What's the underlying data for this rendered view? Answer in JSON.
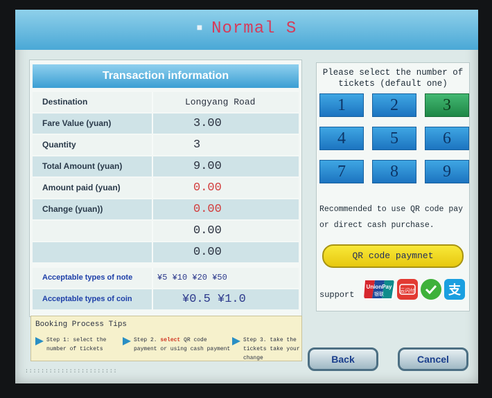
{
  "header": {
    "title": "Normal S"
  },
  "transaction": {
    "title": "Transaction information",
    "rows": [
      {
        "label": "Destination",
        "value": "Longyang Road"
      },
      {
        "label": "Fare Value (yuan)",
        "value": "3.00"
      },
      {
        "label": "Quantity",
        "value": "3"
      },
      {
        "label": "Total Amount (yuan)",
        "value": "9.00"
      },
      {
        "label": "Amount paid (yuan)",
        "value": "0.00"
      },
      {
        "label": "Change (yuan))",
        "value": "0.00"
      },
      {
        "label": "",
        "value": "0.00"
      },
      {
        "label": "",
        "value": "0.00"
      }
    ],
    "notes_label": "Acceptable types of note",
    "notes_value": "¥5 ¥10 ¥20 ¥50",
    "coins_label": "Acceptable types of coin",
    "coins_value": "¥0.5 ¥1.0"
  },
  "tickets": {
    "prompt": "Please select the number of tickets (default one)",
    "numbers": [
      "1",
      "2",
      "3",
      "4",
      "5",
      "6",
      "7",
      "8",
      "9"
    ],
    "selected": "3",
    "recommend": "Recommended to use QR code pay or direct cash purchase.",
    "qr_button": "QR code paymnet",
    "support_label": "support",
    "payment_icons": [
      "unionpay-icon",
      "cloud-quickpass-icon",
      "wechat-pay-icon",
      "alipay-icon"
    ],
    "unionpay_text": "UnionPay",
    "unionpay_sub": "银联",
    "quickpass_text": "云闪付",
    "alipay_glyph": "支"
  },
  "tips": {
    "title": "Booking Process Tips",
    "step1_prefix": "Step 1:",
    "step1_text": "select the number of tickets",
    "step2_prefix": "Step 2.",
    "step2_em": "select",
    "step2_text": "QR code payment or using cash payment",
    "step3_prefix": "Step 3.",
    "step3_text": "take the tickets take your change"
  },
  "buttons": {
    "back": "Back",
    "cancel": "Cancel"
  },
  "colors": {
    "accent": "#3a9ed3",
    "selected": "#2e9a55",
    "qr_button": "#f0d828",
    "red_value": "#d23c3c"
  }
}
